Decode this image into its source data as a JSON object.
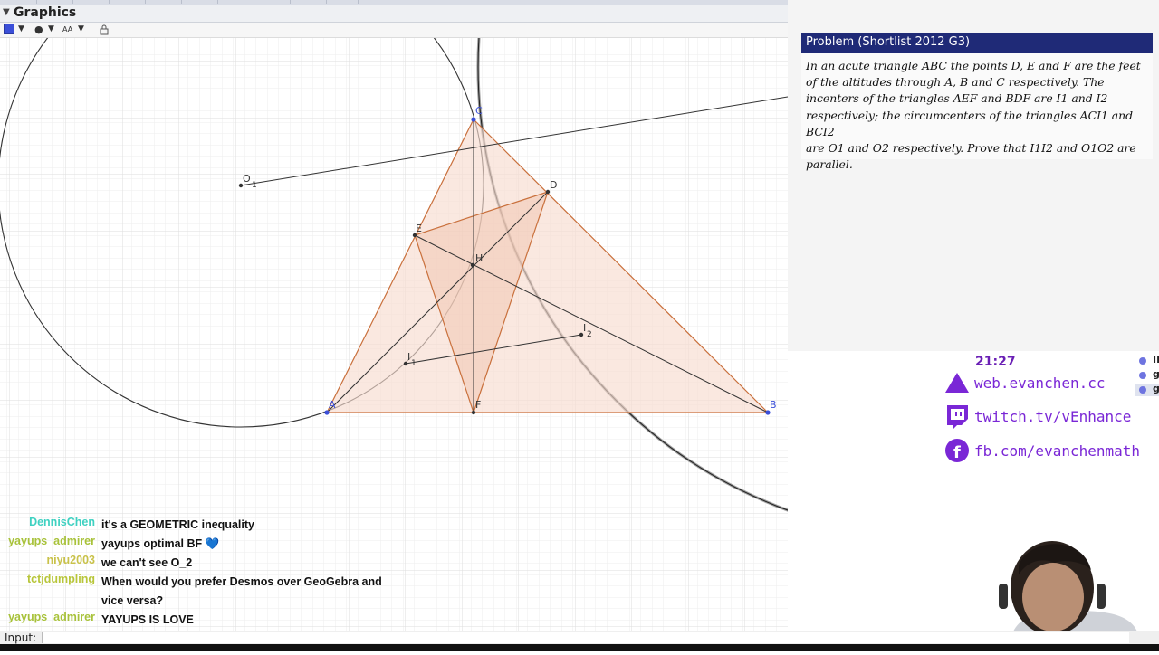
{
  "graphics_panel": {
    "title": "Graphics",
    "point_labels": {
      "C": "C",
      "D": "D",
      "E": "E",
      "H": "H",
      "A": "A",
      "B": "B",
      "F": "F",
      "O1_letter": "O",
      "O1_sub": "1",
      "I1_letter": "I",
      "I1_sub": "1",
      "I2_letter": "I",
      "I2_sub": "2"
    }
  },
  "problem": {
    "heading": "Problem (Shortlist 2012 G3)",
    "text_lines": [
      "In an acute triangle ABC the points D, E and F are the feet",
      "of the altitudes through A, B and C respectively.  The",
      "incenters of the triangles AEF and BDF are I1 and I2",
      "respectively; the circumcenters of the triangles ACI1 and BCI2",
      "are O1 and O2 respectively.  Prove that I1I2 and O1O2 are",
      "parallel."
    ]
  },
  "stream_overlay": {
    "clock": "21:27",
    "links": [
      {
        "icon": "triangle-logo-icon",
        "text": "web.evanchen.cc"
      },
      {
        "icon": "twitch-icon",
        "text": "twitch.tv/vEnhance"
      },
      {
        "icon": "facebook-icon",
        "text": "fb.com/evanchenmath"
      }
    ],
    "side_items": [
      "II",
      "g",
      "g"
    ]
  },
  "chat": {
    "messages": [
      {
        "user": "DennisChen",
        "user_color": "#3fd1c1",
        "text": "it's a GEOMETRIC inequality"
      },
      {
        "user": "yayups_admirer",
        "user_color": "#a8c23a",
        "text": "yayups optimal BF 💙"
      },
      {
        "user": "niyu2003",
        "user_color": "#c9c24a",
        "text": "we can't see O_2"
      },
      {
        "user": "tctjdumpling",
        "user_color": "#b8c63a",
        "text": "When would you prefer Desmos over GeoGebra and vice versa?"
      },
      {
        "user": "yayups_admirer",
        "user_color": "#a8c23a",
        "text": "YAYUPS IS LOVE"
      }
    ]
  },
  "input_bar": {
    "label": "Input:",
    "value": ""
  },
  "colors": {
    "triangle_edge": "#c9703c",
    "triangle_fill": "#f7dccf",
    "point_blue": "#3b4fd8",
    "header_navy": "#1f2a77",
    "overlay_purple": "#7a27d6"
  }
}
